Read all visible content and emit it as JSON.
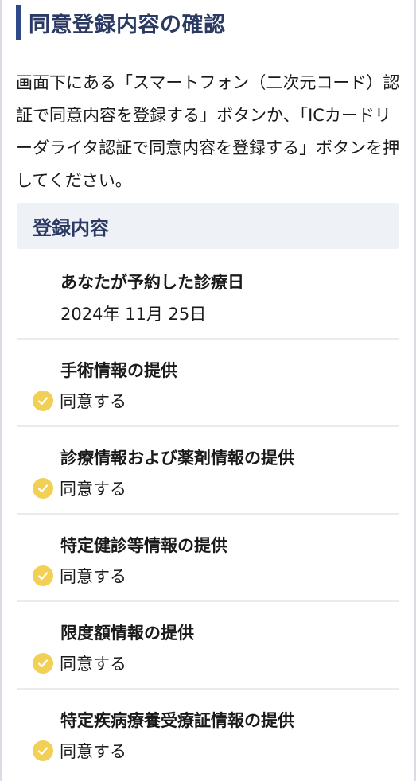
{
  "page": {
    "title": "同意登録内容の確認",
    "instructions": "画面下にある「スマートフォン（二次元コード）認証で同意内容を登録する」ボタンか、「ICカードリーダライタ認証で同意内容を登録する」ボタンを押してください。"
  },
  "registration": {
    "section_title": "登録内容",
    "appointment": {
      "label": "あなたが予約した診療日",
      "value": "2024年 11月 25日"
    },
    "items": [
      {
        "label": "手術情報の提供",
        "status": "同意する"
      },
      {
        "label": "診療情報および薬剤情報の提供",
        "status": "同意する"
      },
      {
        "label": "特定健診等情報の提供",
        "status": "同意する"
      },
      {
        "label": "限度額情報の提供",
        "status": "同意する"
      },
      {
        "label": "特定疾病療養受療証情報の提供",
        "status": "同意する"
      }
    ]
  },
  "icons": {
    "status": "check-circle-icon"
  },
  "colors": {
    "heading": "#2b3a63",
    "accent_bar": "#2f4a8a",
    "section_bg": "#eef1f6",
    "check": "#f2cf55"
  }
}
